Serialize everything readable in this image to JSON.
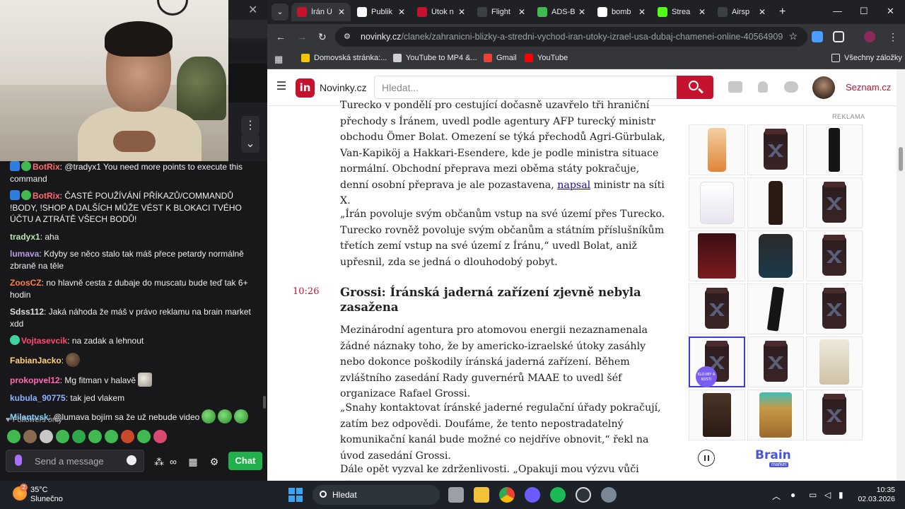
{
  "stream": {
    "chat": {
      "messages": [
        {
          "user": "BotRix",
          "user_color": "#ff6b6b",
          "text": ": @tradyx1 You need more points to execute this command",
          "badges": [
            "bot-badge",
            "verified-badge"
          ]
        },
        {
          "user": "BotRix",
          "user_color": "#ff6b6b",
          "text": ": ČASTÉ POUŽÍVÁNÍ PŘÍKAZŮ/COMMANDŮ !BODY, !SHOP A DALŠÍCH MŮŽE VÉST K BLOKACI TVÉHO ÚČTU A ZTRÁTĚ VŠECH BODŮ!",
          "badges": [
            "bot-badge",
            "verified-badge"
          ]
        },
        {
          "user": "tradyx1",
          "user_color": "#b9e6b0",
          "text": ": aha"
        },
        {
          "user": "lumava",
          "user_color": "#b99ae6",
          "text": ": Kdyby se něco stalo tak máš přece petardy normálně zbraně na těle"
        },
        {
          "user": "ZoosCZ",
          "user_color": "#ff7f50",
          "text": ": no hlavně cesta z dubaje do muscatu bude teď tak 6+ hodin"
        },
        {
          "user": "Sdss112",
          "user_color": "#e0e0e0",
          "text": ": Jaká náhoda že máš v právo reklamu na brain market xdd"
        },
        {
          "user": "Vojtasevcik",
          "user_color": "#ff4b6e",
          "text": ": na zadak a lehnout",
          "badges": [
            "sub-badge"
          ]
        },
        {
          "user": "FabianJacko",
          "user_color": "#ffd27a",
          "text": ":",
          "emotes": [
            "emote-brown"
          ]
        },
        {
          "user": "prokopvel12",
          "user_color": "#ff69b4",
          "text": ": Mg fitman v halavě",
          "emotes": [
            "emote-white"
          ]
        },
        {
          "user": "kubula_90775",
          "user_color": "#8ab4ff",
          "text": ": tak jed vlakem"
        },
        {
          "user": "Milantvsk",
          "user_color": "#7fd3ff",
          "text": ": @lumava bojím sa že už nebude video",
          "emotes": [
            "emote-green",
            "emote-green",
            "emote-green"
          ]
        }
      ],
      "followers_only": "Followers only",
      "input_placeholder": "Send a message",
      "chat_button": "Chat"
    }
  },
  "browser": {
    "tabs": [
      {
        "label": "Írán Ú",
        "favicon_color": "#c4122f",
        "active": true
      },
      {
        "label": "Publik",
        "favicon_color": "#ffffff"
      },
      {
        "label": "Útok n",
        "favicon_color": "#c4122f"
      },
      {
        "label": "Flight",
        "favicon_color": "#3c4043"
      },
      {
        "label": "ADS-B",
        "favicon_color": "#3fb950"
      },
      {
        "label": "bomb",
        "favicon_color": "#ffffff"
      },
      {
        "label": "Strea",
        "favicon_color": "#53fc18"
      },
      {
        "label": "Airsp",
        "favicon_color": "#3c4043"
      }
    ],
    "url_domain": "novinky.cz",
    "url_path": "/clanek/zahranicni-blizky-a-stredni-vychod-iran-utoky-izrael-usa-dubaj-chamenei-online-40564909",
    "bookmarks": [
      {
        "label": "Domovská stránka:...",
        "color": "#f5c400"
      },
      {
        "label": "YouTube to MP4 &...",
        "color": "#d0d0d0"
      },
      {
        "label": "Gmail",
        "color": "#ea4335"
      },
      {
        "label": "YouTube",
        "color": "#ff0000"
      }
    ],
    "all_bookmarks": "Všechny záložky"
  },
  "site": {
    "logo_text": "in",
    "name": "Novinky.cz",
    "search_placeholder": "Hledat...",
    "seznam_link": "Seznam.cz",
    "article": {
      "p1": "Turecko v pondělí pro cestující dočasně uzavřelo tři hraniční přechody s Íránem, uvedl podle agentury AFP turecký ministr obchodu Ömer Bolat. Omezení se týká přechodů Agri-Gürbulak, Van-Kapiköj a Hakkari-Esendere, kde je podle ministra situace normální. Obchodní přeprava mezi oběma státy pokračuje, denní osobní přeprava je ale pozastavena,",
      "p1_link": "napsal",
      "p1_end": " ministr na síti X.",
      "p2": "„Írán povoluje svým občanům vstup na své území přes Turecko. Turecko rovněž povoluje svým občanům a státním příslušníkům třetích zemí vstup na své území z Íránu,“ uvedl Bolat, aniž upřesnil, zda se jedná o dlouhodobý pobyt.",
      "time": "10:26",
      "headline": "Grossi: Íránská jaderná zařízení zjevně nebyla zasažena",
      "p3": "Mezinárodní agentura pro atomovou energii nezaznamenala žádné náznaky toho, že by americko-izraelské útoky zasáhly nebo dokonce poškodily íránská jaderná zařízení. Během zvláštního zasedání Rady guvernérů MAAE to uvedl šéf organizace Rafael Grossi.",
      "p4": "„Snahy kontaktovat íránské jaderné regulační úřady pokračují, zatím bez odpovědi. Doufáme, že tento nepostradatelný komunikační kanál bude možné co nejdříve obnovit,“ řekl na úvod zasedání Grossi.",
      "p5": "Dále opět vyzval ke zdrženlivosti. „Opakuji mou výzvu vůči všem"
    },
    "ad": {
      "label": "REKLAMA",
      "brand": "Brain",
      "brand_sub": "market",
      "selected_badge": "KLOUBY A KOSTI"
    }
  },
  "taskbar": {
    "temperature": "35°C",
    "weather": "Slunečno",
    "weather_badge": "2",
    "search_placeholder": "Hledat",
    "time": "10:35",
    "date": "02.03.2026"
  }
}
